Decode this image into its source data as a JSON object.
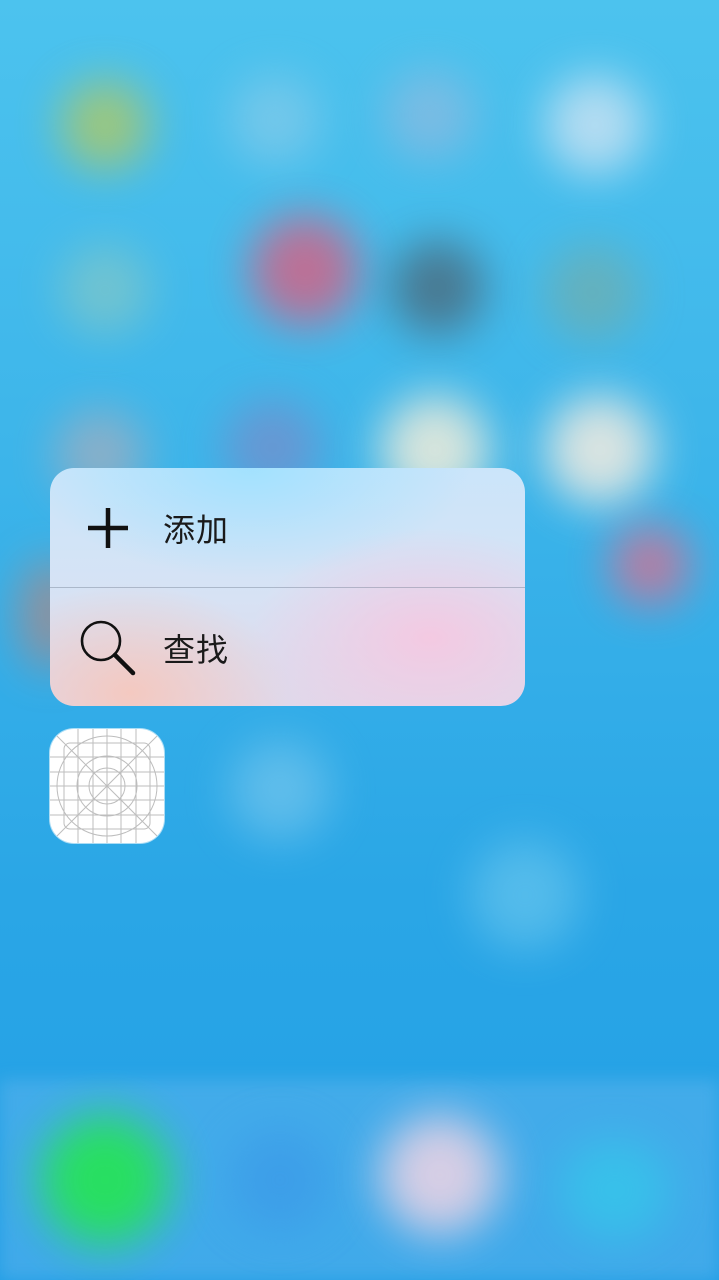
{
  "menu": {
    "items": [
      {
        "label": "添加",
        "icon": "plus-icon"
      },
      {
        "label": "查找",
        "icon": "search-icon"
      }
    ]
  },
  "app_icon": {
    "icon": "app-template-grid-icon"
  },
  "colors": {
    "background_top": "#4cc3ee",
    "background_bottom": "#229fe6",
    "menu_text": "#1a1a1a"
  }
}
